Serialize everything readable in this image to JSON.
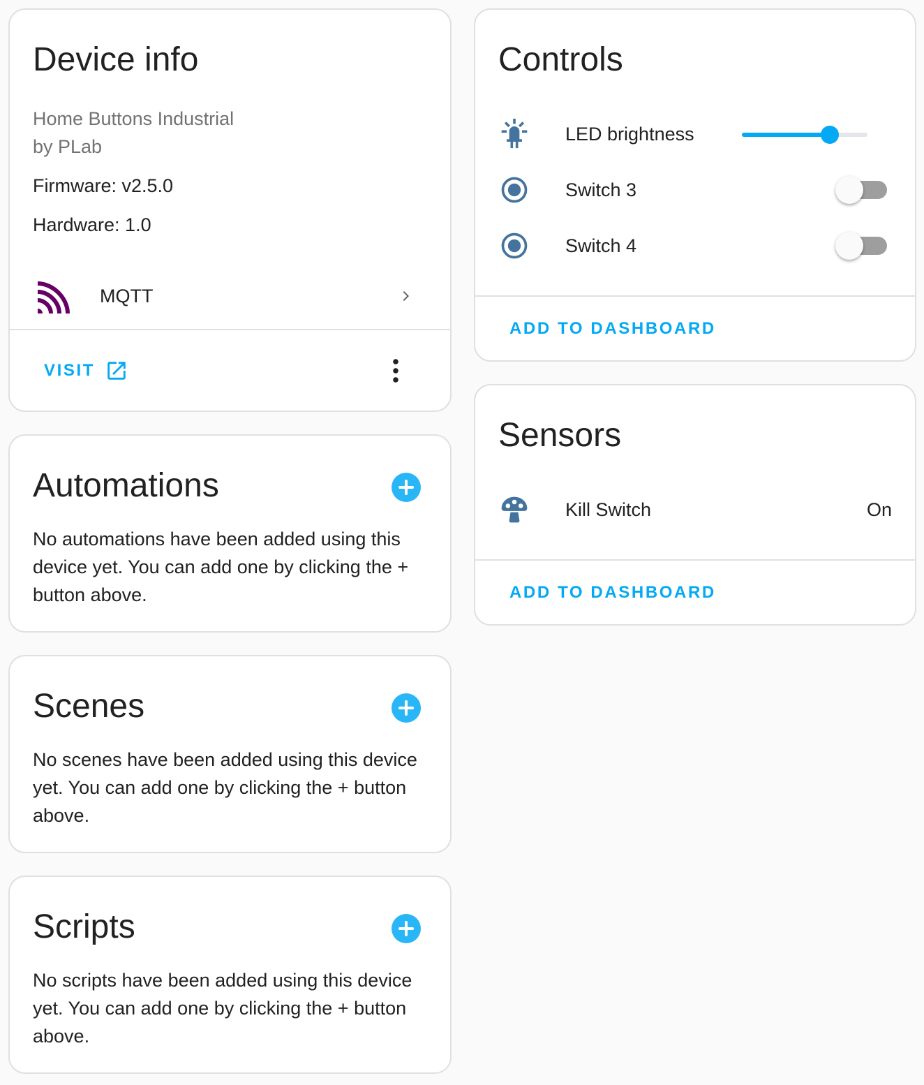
{
  "device_info": {
    "title": "Device info",
    "model": "Home Buttons Industrial",
    "manufacturer": "by PLab",
    "firmware": "Firmware: v2.5.0",
    "hardware": "Hardware: 1.0",
    "integration": {
      "label": "MQTT",
      "icon": "mqtt-logo",
      "icon_color": "#660066"
    },
    "visit_label": "Visit",
    "menu_icon": "dots-vertical-icon"
  },
  "automations": {
    "title": "Automations",
    "empty_text": "No automations have been added using this device yet. You can add one by clicking the + button above."
  },
  "scenes": {
    "title": "Scenes",
    "empty_text": "No scenes have been added using this device yet. You can add one by clicking the + button above."
  },
  "scripts": {
    "title": "Scripts",
    "empty_text": "No scripts have been added using this device yet. You can add one by clicking the + button above."
  },
  "controls": {
    "title": "Controls",
    "entities": [
      {
        "label": "LED brightness",
        "icon": "led-icon",
        "type": "slider",
        "value": 0.7
      },
      {
        "label": "Switch 3",
        "icon": "radiobox-marked-icon",
        "type": "toggle",
        "state": "off"
      },
      {
        "label": "Switch 4",
        "icon": "radiobox-marked-icon",
        "type": "toggle",
        "state": "off"
      }
    ],
    "add_to_dashboard": "Add to dashboard"
  },
  "sensors": {
    "title": "Sensors",
    "entities": [
      {
        "label": "Kill Switch",
        "icon": "mushroom-icon",
        "value": "On"
      }
    ],
    "add_to_dashboard": "Add to dashboard"
  },
  "colors": {
    "accent": "#03a9f4",
    "fab": "#29b6f6",
    "entity_icon": "#44739e",
    "toggle_off_track": "#9e9e9e"
  }
}
